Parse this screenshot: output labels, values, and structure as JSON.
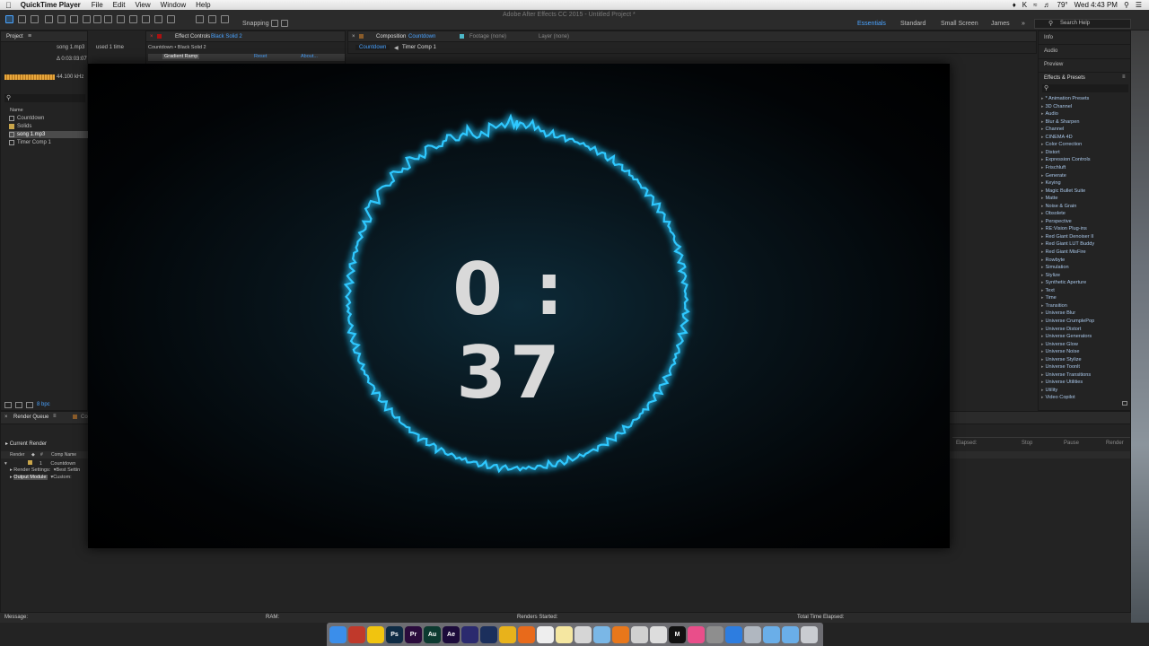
{
  "menubar": {
    "app_name": "QuickTime Player",
    "items": [
      "File",
      "Edit",
      "View",
      "Window",
      "Help"
    ],
    "battery": "79°",
    "clock": "Wed 4:43 PM"
  },
  "toolbar": {
    "window_title": "Adobe After Effects CC 2015 - Untitled Project *",
    "snapping": "Snapping",
    "workspaces": [
      "Essentials",
      "Standard",
      "Small Screen",
      "James"
    ],
    "search_help": "Search Help"
  },
  "project": {
    "tab": "Project",
    "footage_name": "song 1.mp3",
    "footage_used": "used 1 time",
    "footage_duration": "Δ 0:03:03:07",
    "audio_rate": "44.100 kHz",
    "col_name": "Name",
    "items": [
      {
        "label": "Countdown",
        "selected": false
      },
      {
        "label": "Solids",
        "selected": false
      },
      {
        "label": "song 1.mp3",
        "selected": true
      },
      {
        "label": "Timer Comp 1",
        "selected": false
      }
    ],
    "bpc": "8 bpc"
  },
  "effect_controls": {
    "tab": "Effect Controls",
    "layer": "Black Solid 2",
    "breadcrumb": "Countdown • Black Solid 2",
    "effect_name": "Gradient Ramp",
    "reset": "Reset",
    "about": "About..."
  },
  "composition": {
    "tab": "Composition",
    "comp_name": "Countdown",
    "footage_tab": "Footage (none)",
    "layer_tab": "Layer (none)",
    "nav": [
      "Countdown",
      "Timer Comp 1"
    ]
  },
  "viewer": {
    "timer_text": "0 : 37",
    "ring_color": "#2fc8ff"
  },
  "right_panels": {
    "info": "Info",
    "audio": "Audio",
    "preview": "Preview",
    "effects_presets": "Effects & Presets",
    "fx_list": [
      "* Animation Presets",
      "3D Channel",
      "Audio",
      "Blur & Sharpen",
      "Channel",
      "CINEMA 4D",
      "Color Correction",
      "Distort",
      "Expression Controls",
      "Frischluft",
      "Generate",
      "Keying",
      "Magic Bullet Suite",
      "Matte",
      "Noise & Grain",
      "Obsolete",
      "Perspective",
      "RE:Vision Plug-ins",
      "Red Giant Denoiser II",
      "Red Giant LUT Buddy",
      "Red Giant MisFire",
      "Rowbyte",
      "Simulation",
      "Stylize",
      "Synthetic Aperture",
      "Text",
      "Time",
      "Transition",
      "Universe Blur",
      "Universe CrumplePop",
      "Universe Distort",
      "Universe Generators",
      "Universe Glow",
      "Universe Noise",
      "Universe Stylize",
      "Universe Toonlt",
      "Universe Transitions",
      "Universe Utilities",
      "Utility",
      "Video Copilot"
    ]
  },
  "render_queue": {
    "tab": "Render Queue",
    "tab2": "Co",
    "current_render": "Current Render",
    "col_render": "Render",
    "col_num": "#",
    "col_comp": "Comp Name",
    "item_num": "1",
    "item_comp": "Countdown",
    "render_settings": "Render Settings:",
    "render_settings_val": "Best Settin",
    "output_module": "Output Module:",
    "output_module_val": "Custom: ",
    "elapsed": "Elapsed:",
    "btn_stop": "Stop",
    "btn_pause": "Pause",
    "btn_render": "Render"
  },
  "statusbar": {
    "message": "Message:",
    "ram": "RAM:",
    "renders_started": "Renders Started:",
    "total_time": "Total Time Elapsed:"
  },
  "dock": {
    "icons": [
      {
        "name": "finder-icon",
        "color": "#3b8eea",
        "label": ""
      },
      {
        "name": "xcode-icon",
        "color": "#c0392b",
        "label": ""
      },
      {
        "name": "duck-icon",
        "color": "#f1c40f",
        "label": ""
      },
      {
        "name": "photoshop-icon",
        "color": "#0e2b44",
        "label": "Ps"
      },
      {
        "name": "premiere-icon",
        "color": "#2a0b3c",
        "label": "Pr"
      },
      {
        "name": "audition-icon",
        "color": "#0c3a30",
        "label": "Au"
      },
      {
        "name": "aftereffects-icon",
        "color": "#1c0b3b",
        "label": "Ae"
      },
      {
        "name": "prism-icon",
        "color": "#2b2a6e",
        "label": ""
      },
      {
        "name": "cinema4d-icon",
        "color": "#1b2f5c",
        "label": ""
      },
      {
        "name": "chrome-icon",
        "color": "#e8b21b",
        "label": ""
      },
      {
        "name": "firefox-icon",
        "color": "#e86a1b",
        "label": ""
      },
      {
        "name": "calendar-icon",
        "color": "#eeeeee",
        "label": ""
      },
      {
        "name": "notes-icon",
        "color": "#f5e7a1",
        "label": ""
      },
      {
        "name": "script-icon",
        "color": "#d6d6d6",
        "label": ""
      },
      {
        "name": "maps-icon",
        "color": "#7ab7e6",
        "label": ""
      },
      {
        "name": "vlc-icon",
        "color": "#e8771b",
        "label": ""
      },
      {
        "name": "mail-icon",
        "color": "#d0d0d0",
        "label": ""
      },
      {
        "name": "clock-icon",
        "color": "#dddddd",
        "label": ""
      },
      {
        "name": "m-app-icon",
        "color": "#111111",
        "label": "M"
      },
      {
        "name": "itunes-icon",
        "color": "#e94e8a",
        "label": ""
      },
      {
        "name": "system-prefs-icon",
        "color": "#8e8e8e",
        "label": ""
      },
      {
        "name": "safari-icon",
        "color": "#2d7de0",
        "label": ""
      },
      {
        "name": "screenshot-icon",
        "color": "#b0b7c0",
        "label": ""
      },
      {
        "name": "folder-icon",
        "color": "#6aaee8",
        "label": ""
      },
      {
        "name": "folder2-icon",
        "color": "#6aaee8",
        "label": ""
      },
      {
        "name": "trash-icon",
        "color": "#c9ccd1",
        "label": ""
      }
    ]
  }
}
